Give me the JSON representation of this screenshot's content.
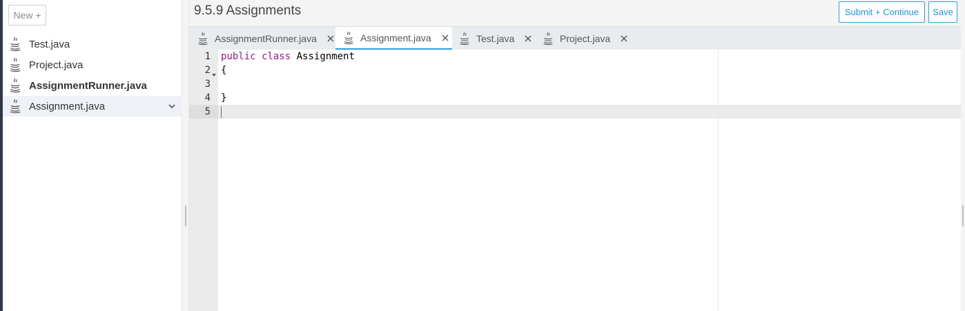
{
  "sidebar": {
    "new_button": "New +",
    "files": [
      {
        "label": "Test.java"
      },
      {
        "label": "Project.java"
      },
      {
        "label": "AssignmentRunner.java"
      },
      {
        "label": "Assignment.java"
      }
    ]
  },
  "header": {
    "title": "9.5.9 Assignments",
    "submit_label": "Submit + Continue",
    "save_label": "Save"
  },
  "tabs": [
    {
      "label": "AssignmentRunner.java"
    },
    {
      "label": "Assignment.java"
    },
    {
      "label": "Test.java"
    },
    {
      "label": "Project.java"
    }
  ],
  "editor": {
    "line_numbers": [
      "1",
      "2",
      "3",
      "4",
      "5"
    ],
    "code": {
      "line1_kw1": "public",
      "line1_kw2": "class",
      "line1_name": "Assignment",
      "line2": "{",
      "line4": "}"
    }
  },
  "colors": {
    "accent": "#2aa0d8",
    "keyword": "#931b87"
  }
}
